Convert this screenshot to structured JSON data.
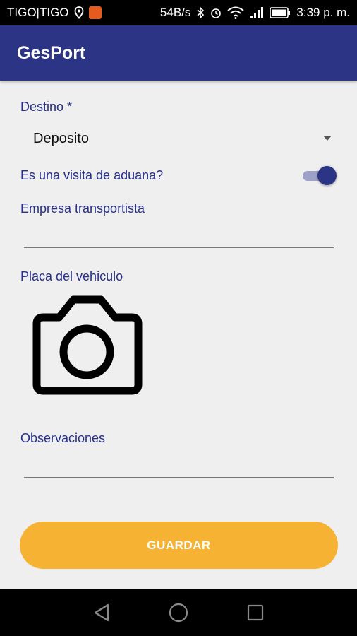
{
  "status_bar": {
    "carrier": "TIGO|TIGO",
    "network_speed": "54B/s",
    "time": "3:39 p. m.",
    "icons": [
      "location-icon",
      "app-notification-icon",
      "bluetooth-icon",
      "alarm-icon",
      "wifi-icon",
      "signal-icon",
      "battery-icon"
    ]
  },
  "app_bar": {
    "title": "GesPort",
    "background": "#2c3585"
  },
  "form": {
    "destino_label": "Destino *",
    "destino_value": "Deposito",
    "aduana_label": "Es una visita de aduana?",
    "aduana_on": true,
    "empresa_label": "Empresa transportista",
    "empresa_value": "",
    "placa_label": "Placa del vehiculo",
    "placa_icon": "camera-icon",
    "observaciones_label": "Observaciones",
    "observaciones_value": ""
  },
  "actions": {
    "save_label": "GUARDAR",
    "save_color": "#f6b233"
  },
  "nav": {
    "icons": [
      "back-icon",
      "home-icon",
      "recents-icon"
    ]
  }
}
